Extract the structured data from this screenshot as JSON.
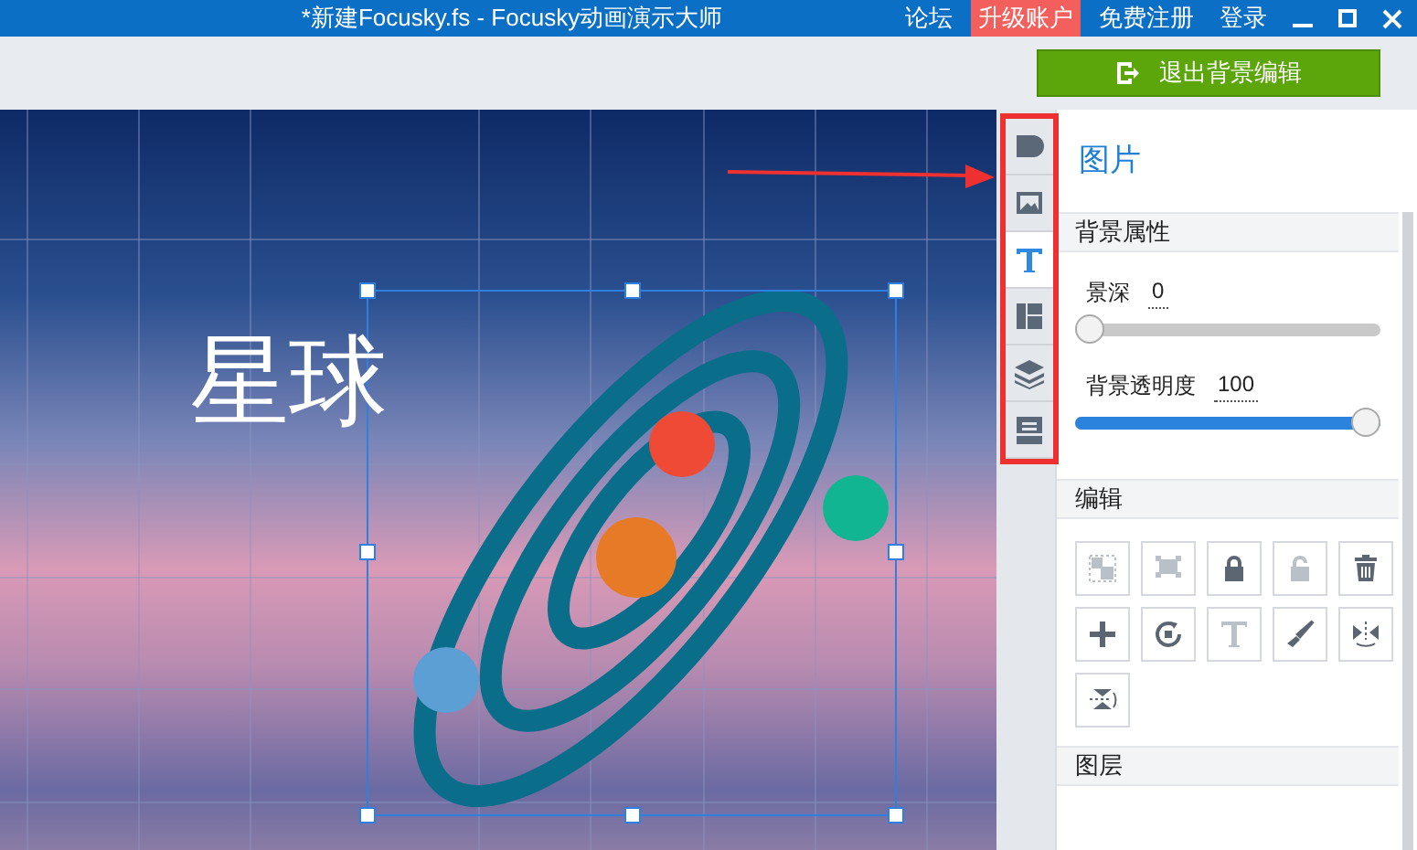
{
  "window": {
    "title": "*新建Focusky.fs - Focusky动画演示大师"
  },
  "header_links": [
    {
      "label": "论坛",
      "highlighted": false
    },
    {
      "label": "升级账户",
      "highlighted": true
    },
    {
      "label": "免费注册",
      "highlighted": false
    },
    {
      "label": "登录",
      "highlighted": false
    }
  ],
  "toolbar": {
    "exit_button": "退出背景编辑"
  },
  "canvas": {
    "text": "星球"
  },
  "side_tabs": [
    {
      "kind": "shape",
      "selected": false
    },
    {
      "kind": "image",
      "selected": false
    },
    {
      "kind": "text",
      "selected": true
    },
    {
      "kind": "layout",
      "selected": false
    },
    {
      "kind": "layers",
      "selected": false
    },
    {
      "kind": "archive",
      "selected": false
    }
  ],
  "panel": {
    "title": "图片",
    "background_section": {
      "heading": "背景属性",
      "sliders": [
        {
          "label": "景深",
          "reading": "0",
          "level": 0
        },
        {
          "label": "背景透明度",
          "reading": "100",
          "level": 1
        }
      ]
    },
    "edit_section": {
      "heading": "编辑",
      "buttons": [
        {
          "kind": "group",
          "disabled": true
        },
        {
          "kind": "ungroup",
          "disabled": true
        },
        {
          "kind": "lock",
          "disabled": false
        },
        {
          "kind": "unlock",
          "disabled": true
        },
        {
          "kind": "delete",
          "disabled": false
        },
        {
          "kind": "add",
          "disabled": false
        },
        {
          "kind": "rotate",
          "disabled": false
        },
        {
          "kind": "text",
          "disabled": true
        },
        {
          "kind": "brush",
          "disabled": false
        },
        {
          "kind": "flip_h",
          "disabled": false
        },
        {
          "kind": "flip_v",
          "disabled": false
        }
      ]
    },
    "layer_section": {
      "heading": "图层"
    }
  }
}
